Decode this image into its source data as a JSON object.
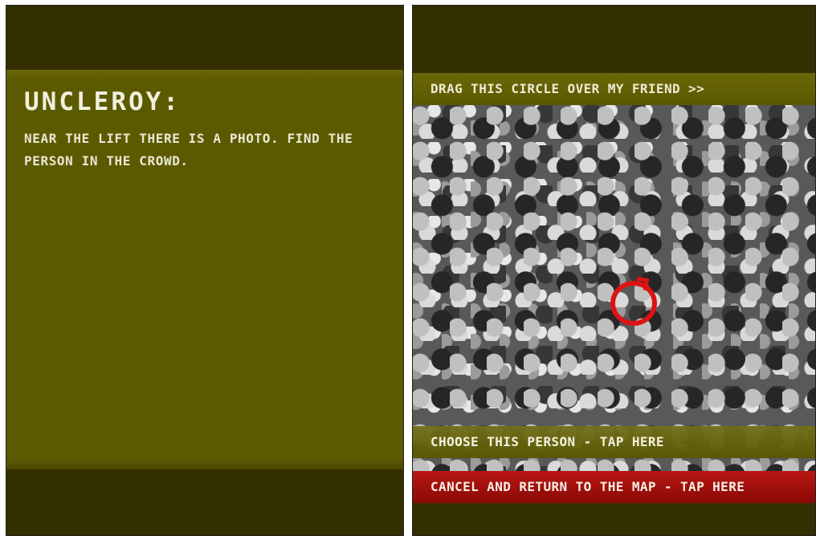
{
  "left_screen": {
    "title": "UNCLEROY:",
    "message": "NEAR THE LIFT THERE IS A PHOTO. FIND THE PERSON IN THE CROWD."
  },
  "right_screen": {
    "instruction": "DRAG THIS CIRCLE OVER MY FRIEND >>",
    "choose_label": "CHOOSE THIS PERSON - TAP HERE",
    "cancel_label": "CANCEL AND RETURN TO THE MAP - TAP HERE"
  },
  "colors": {
    "olive_panel": "#5c5a00",
    "dark_band": "#342f00",
    "cancel_red": "#a8100c",
    "circle_red": "#d81818",
    "text_light": "#ecebd2"
  }
}
